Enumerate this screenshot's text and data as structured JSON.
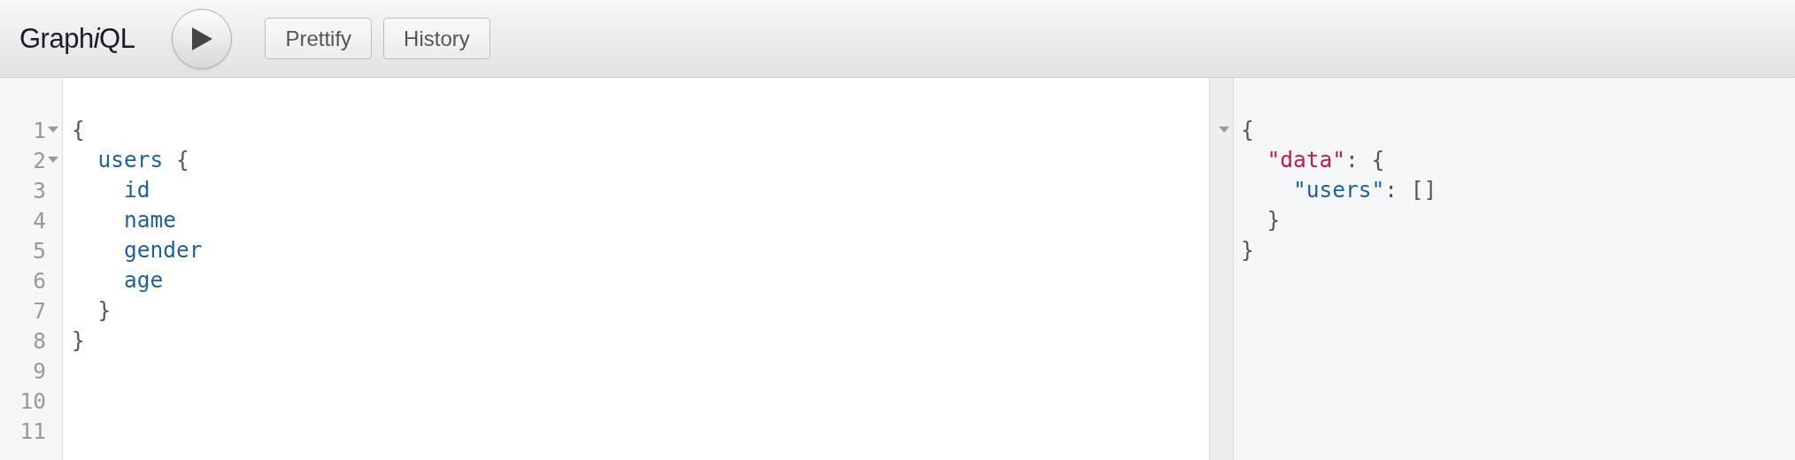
{
  "toolbar": {
    "logo": [
      {
        "text": "Graph",
        "italic": false
      },
      {
        "text": "i",
        "italic": true
      },
      {
        "text": "QL",
        "italic": false
      }
    ],
    "buttons": [
      {
        "label": "Prettify"
      },
      {
        "label": "History"
      }
    ]
  },
  "query_editor": {
    "lines": [
      {
        "number": "1",
        "foldable": true,
        "tokens": [
          {
            "text": "{",
            "kind": "punct"
          }
        ]
      },
      {
        "number": "2",
        "foldable": true,
        "tokens": [
          {
            "text": "  users",
            "kind": "field"
          },
          {
            "text": " {",
            "kind": "punct"
          }
        ]
      },
      {
        "number": "3",
        "foldable": false,
        "tokens": [
          {
            "text": "    id",
            "kind": "field"
          }
        ]
      },
      {
        "number": "4",
        "foldable": false,
        "tokens": [
          {
            "text": "    name",
            "kind": "field"
          }
        ]
      },
      {
        "number": "5",
        "foldable": false,
        "tokens": [
          {
            "text": "    gender",
            "kind": "field"
          }
        ]
      },
      {
        "number": "6",
        "foldable": false,
        "tokens": [
          {
            "text": "    age",
            "kind": "field"
          }
        ]
      },
      {
        "number": "7",
        "foldable": false,
        "tokens": [
          {
            "text": "  }",
            "kind": "punct"
          }
        ]
      },
      {
        "number": "8",
        "foldable": false,
        "tokens": [
          {
            "text": "}",
            "kind": "punct"
          }
        ]
      },
      {
        "number": "9",
        "foldable": false
      },
      {
        "number": "10",
        "foldable": false
      },
      {
        "number": "11",
        "foldable": false
      }
    ]
  },
  "result_viewer": {
    "lines": [
      {
        "foldable": true,
        "tokens": [
          {
            "text": "{",
            "kind": "punct"
          }
        ]
      },
      {
        "foldable": false,
        "tokens": [
          {
            "text": "  \"data\"",
            "kind": "key"
          },
          {
            "text": ": {",
            "kind": "punct"
          }
        ]
      },
      {
        "foldable": false,
        "tokens": [
          {
            "text": "    \"users\"",
            "kind": "string"
          },
          {
            "text": ": []",
            "kind": "punct"
          }
        ]
      },
      {
        "foldable": false,
        "tokens": [
          {
            "text": "  }",
            "kind": "punct"
          }
        ]
      },
      {
        "foldable": false,
        "tokens": [
          {
            "text": "}",
            "kind": "punct"
          }
        ]
      }
    ]
  }
}
